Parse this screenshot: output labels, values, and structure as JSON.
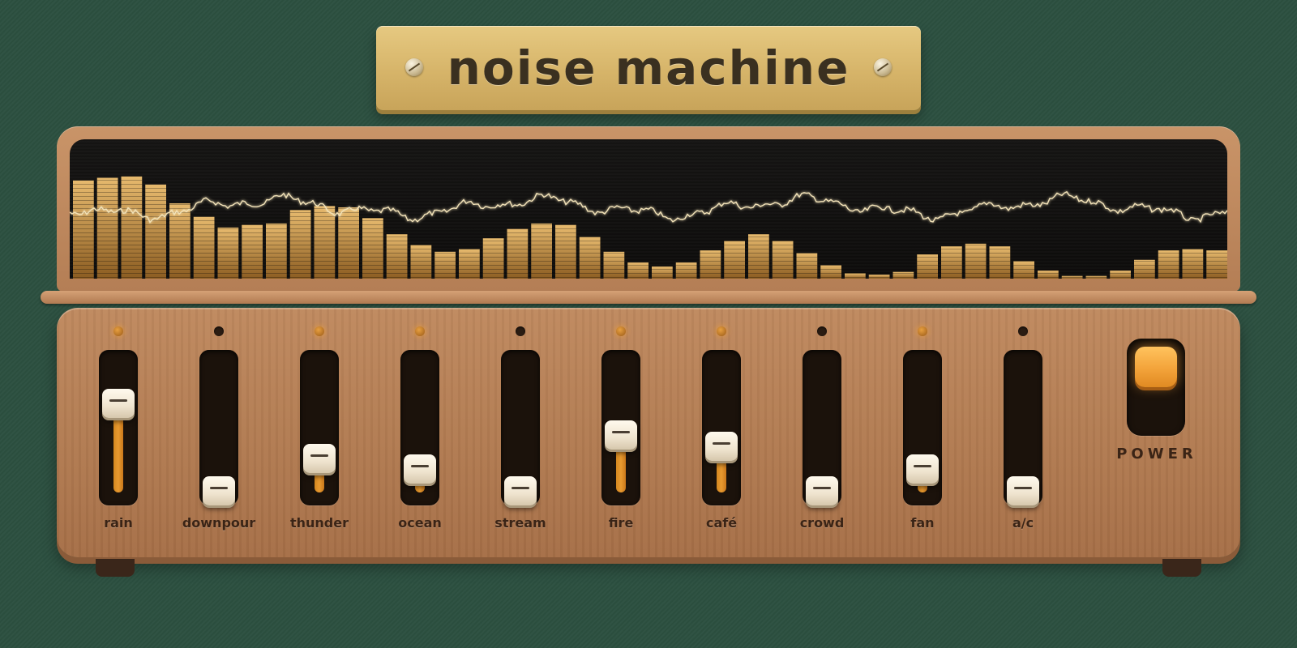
{
  "app": {
    "title": "noise machine"
  },
  "colors": {
    "background": "#2c5040",
    "brass": "#d6b469",
    "wood": "#b27b51",
    "amber": "#e89a30",
    "screen": "#0f0e0d"
  },
  "icons": {
    "nameplate_screws": "screw-icon"
  },
  "spectrum": {
    "levels": [
      0.73,
      0.75,
      0.76,
      0.7,
      0.56,
      0.46,
      0.38,
      0.4,
      0.41,
      0.51,
      0.54,
      0.53,
      0.45,
      0.33,
      0.25,
      0.2,
      0.22,
      0.3,
      0.37,
      0.41,
      0.4,
      0.31,
      0.2,
      0.12,
      0.09,
      0.12,
      0.21,
      0.28,
      0.33,
      0.28,
      0.19,
      0.1,
      0.04,
      0.03,
      0.05,
      0.18,
      0.24,
      0.26,
      0.24,
      0.13,
      0.06,
      0.02,
      0.02,
      0.06,
      0.14,
      0.21,
      0.22,
      0.21
    ]
  },
  "channels": [
    {
      "name": "rain",
      "level": 0.72,
      "active": true
    },
    {
      "name": "downpour",
      "level": 0.0,
      "active": false
    },
    {
      "name": "thunder",
      "level": 0.27,
      "active": true
    },
    {
      "name": "ocean",
      "level": 0.18,
      "active": true
    },
    {
      "name": "stream",
      "level": 0.0,
      "active": false
    },
    {
      "name": "fire",
      "level": 0.46,
      "active": true
    },
    {
      "name": "café",
      "level": 0.37,
      "active": true
    },
    {
      "name": "crowd",
      "level": 0.0,
      "active": false
    },
    {
      "name": "fan",
      "level": 0.18,
      "active": true
    },
    {
      "name": "a/c",
      "level": 0.0,
      "active": false
    }
  ],
  "power": {
    "label": "POWER",
    "on": true
  }
}
